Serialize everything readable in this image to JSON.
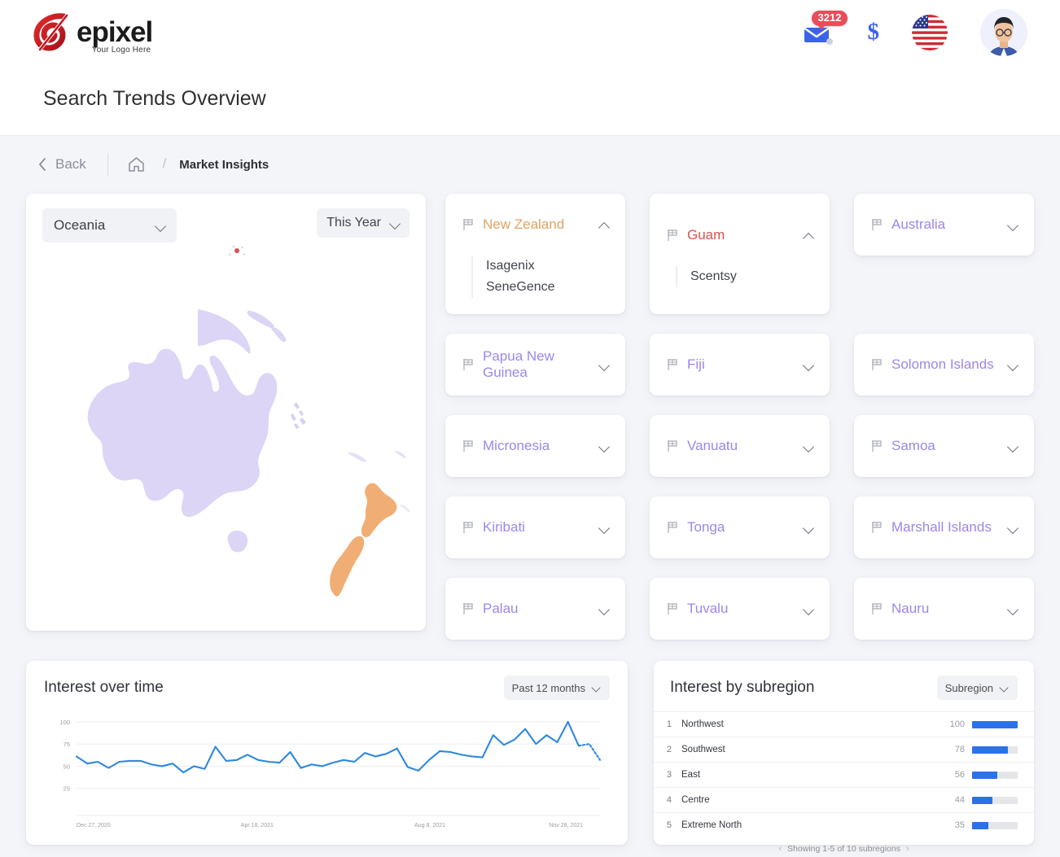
{
  "brand": {
    "name": "epixel",
    "tagline": "Your Logo Here",
    "registered_mark": "®"
  },
  "header": {
    "mail_badge_count": "3212",
    "icons": [
      "mail-icon",
      "dollar-icon",
      "us-flag-icon",
      "avatar-icon"
    ]
  },
  "page_title": "Search Trends Overview",
  "breadcrumb": {
    "back_label": "Back",
    "home_icon": "home-icon",
    "separator": "/",
    "current": "Market Insights"
  },
  "map_panel": {
    "region_select": "Oceania",
    "time_select": "This Year",
    "colors": {
      "region_fill": "#ddd5f5",
      "highlight_fill": "#f0ae74",
      "marker": "#d9534f"
    }
  },
  "countries": [
    {
      "name": "New Zealand",
      "color": "orange",
      "expanded": true,
      "brands": [
        "Isagenix",
        "SeneGence"
      ]
    },
    {
      "name": "Guam",
      "color": "red",
      "expanded": true,
      "brands": [
        "Scentsy"
      ]
    },
    {
      "name": "Australia",
      "color": "purple",
      "expanded": false,
      "brands": []
    },
    {
      "name": "Papua New Guinea",
      "color": "purple",
      "expanded": false,
      "brands": []
    },
    {
      "name": "Fiji",
      "color": "purple",
      "expanded": false,
      "brands": []
    },
    {
      "name": "Solomon Islands",
      "color": "purple",
      "expanded": false,
      "brands": []
    },
    {
      "name": "Micronesia",
      "color": "purple",
      "expanded": false,
      "brands": []
    },
    {
      "name": "Vanuatu",
      "color": "purple",
      "expanded": false,
      "brands": []
    },
    {
      "name": "Samoa",
      "color": "purple",
      "expanded": false,
      "brands": []
    },
    {
      "name": "Kiribati",
      "color": "purple",
      "expanded": false,
      "brands": []
    },
    {
      "name": "Tonga",
      "color": "purple",
      "expanded": false,
      "brands": []
    },
    {
      "name": "Marshall Islands",
      "color": "purple",
      "expanded": false,
      "brands": []
    },
    {
      "name": "Palau",
      "color": "purple",
      "expanded": false,
      "brands": []
    },
    {
      "name": "Tuvalu",
      "color": "purple",
      "expanded": false,
      "brands": []
    },
    {
      "name": "Nauru",
      "color": "purple",
      "expanded": false,
      "brands": []
    }
  ],
  "interest_over_time": {
    "title": "Interest over time",
    "range_select": "Past 12 months"
  },
  "interest_by_subregion": {
    "title": "Interest by subregion",
    "scope_select": "Subregion",
    "rows": [
      {
        "rank": "1",
        "name": "Northwest",
        "value": "100"
      },
      {
        "rank": "2",
        "name": "Southwest",
        "value": "78"
      },
      {
        "rank": "3",
        "name": "East",
        "value": "56"
      },
      {
        "rank": "4",
        "name": "Centre",
        "value": "44"
      },
      {
        "rank": "5",
        "name": "Extreme North",
        "value": "35"
      }
    ],
    "footer": "Showing 1-5 of 10 subregions",
    "prev_arrow": "‹",
    "next_arrow": "›"
  },
  "chart_data": [
    {
      "type": "line",
      "title": "Interest over time",
      "xlabel": "",
      "ylabel": "",
      "ylim": [
        0,
        110
      ],
      "yticks": [
        25,
        50,
        75,
        100
      ],
      "xticks": [
        "Dec 27, 2020",
        "Apr 18, 2021",
        "Aug 8, 2021",
        "Nov 28, 2021"
      ],
      "grid": true,
      "legend": "none",
      "line_color": "#2f87de",
      "dashed_tail_points": 2,
      "values": [
        61,
        53,
        55,
        48,
        55,
        56,
        56,
        52,
        50,
        53,
        43,
        50,
        47,
        72,
        56,
        57,
        63,
        57,
        55,
        54,
        66,
        48,
        52,
        50,
        54,
        57,
        55,
        65,
        61,
        64,
        70,
        49,
        45,
        57,
        67,
        66,
        63,
        61,
        60,
        85,
        74,
        80,
        92,
        75,
        85,
        77,
        100,
        73,
        75,
        57
      ]
    },
    {
      "type": "bar",
      "title": "Interest by subregion",
      "orientation": "horizontal",
      "categories": [
        "Northwest",
        "Southwest",
        "East",
        "Centre",
        "Extreme North"
      ],
      "values": [
        100,
        78,
        56,
        44,
        35
      ],
      "ylim": [
        0,
        100
      ],
      "bar_color": "#2c71e8",
      "track_color": "#e5e6ea"
    }
  ]
}
